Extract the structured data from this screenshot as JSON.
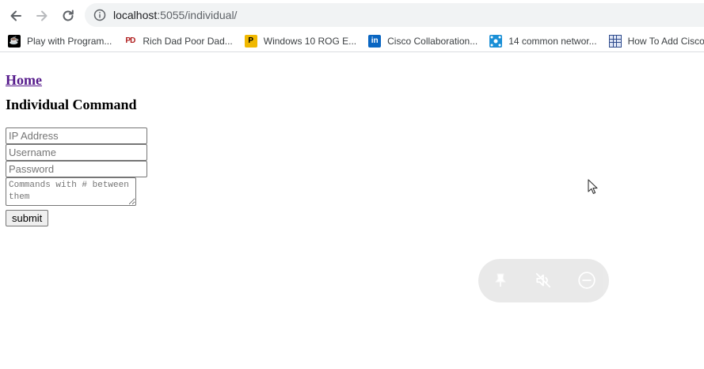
{
  "browser": {
    "url_host": "localhost",
    "url_path": ":5055/individual/",
    "bookmarks": [
      {
        "label": "Play with Program...",
        "icon": "java-icon"
      },
      {
        "label": "Rich Dad Poor Dad...",
        "icon": "pd-icon"
      },
      {
        "label": "Windows 10 ROG E...",
        "icon": "rog-icon"
      },
      {
        "label": "Cisco Collaboration...",
        "icon": "linkedin-icon"
      },
      {
        "label": "14 common networ...",
        "icon": "network-icon"
      },
      {
        "label": "How To Add Cisco",
        "icon": "grid-icon"
      }
    ]
  },
  "page": {
    "home_link": "Home",
    "title": "Individual Command",
    "form": {
      "ip_placeholder": "IP Address",
      "username_placeholder": "Username",
      "password_placeholder": "Password",
      "commands_placeholder": "Commands with # between them",
      "submit_label": "submit"
    }
  },
  "overlay": {
    "icons": [
      "pin-icon",
      "mute-icon",
      "minus-icon"
    ]
  },
  "colors": {
    "link_visited": "#551a8b",
    "omnibox_bg": "#f1f3f4"
  }
}
